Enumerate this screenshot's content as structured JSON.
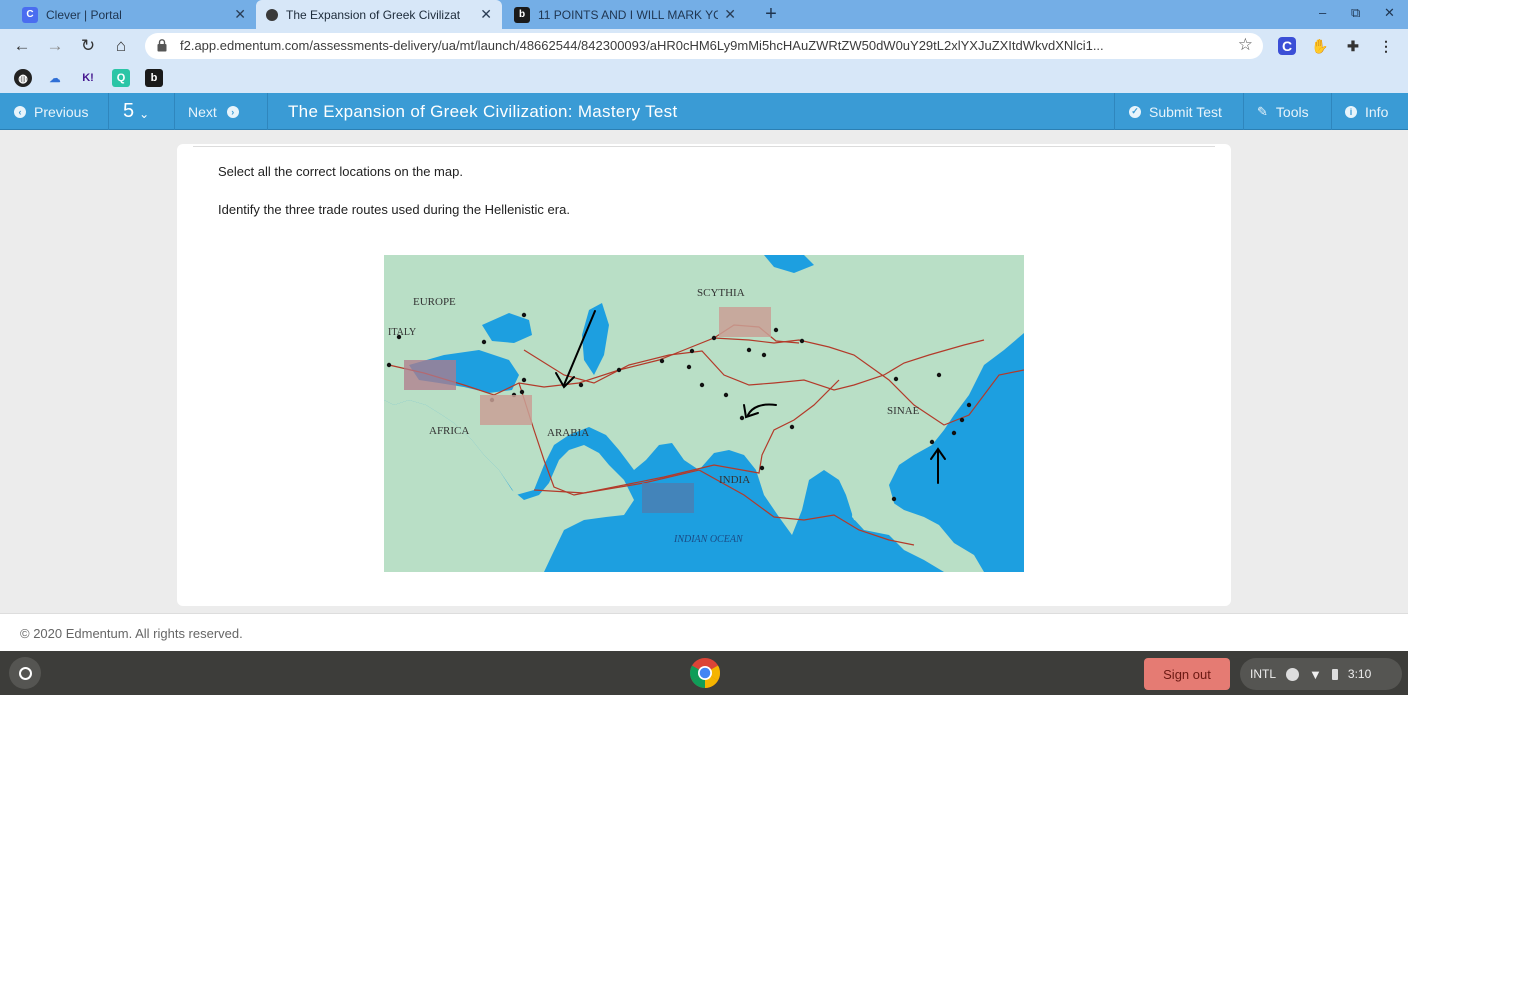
{
  "browser": {
    "tabs": [
      {
        "title": "Clever | Portal",
        "favicon": "C",
        "favicon_color": "#4a6df0",
        "active": false
      },
      {
        "title": "The Expansion of Greek Civilizat",
        "favicon": "e",
        "favicon_color": "#3a3a3a",
        "active": true
      },
      {
        "title": "11 POINTS AND I WILL MARK YO",
        "favicon": "b",
        "favicon_color": "#1a1a1a",
        "active": false
      }
    ],
    "new_tab_glyph": "+",
    "window_controls": [
      "–",
      "⧉",
      "✕"
    ],
    "url": "f2.app.edmentum.com/assessments-delivery/ua/mt/launch/48662544/842300093/aHR0cHM6Ly9mMi5hcHAuZWRtZW50dW0uY29tL2xlYXJuZXItdWkvdXNlci1...",
    "nav_icons": [
      "back-icon",
      "forward-icon",
      "reload-icon",
      "home-icon"
    ],
    "extensions": [
      "clever-extension-icon",
      "hand-extension-icon",
      "puzzle-extensions-icon",
      "menu-dots-icon"
    ],
    "bookmarks": [
      "globe-bookmark-icon",
      "weather-bookmark-icon",
      "kahoot-bookmark-icon",
      "quizizz-bookmark-icon",
      "brainly-bookmark-icon"
    ]
  },
  "app": {
    "previous_label": "Previous",
    "question_number": "5",
    "next_label": "Next",
    "title": "The Expansion of Greek Civilization: Mastery Test",
    "submit_label": "Submit Test",
    "tools_label": "Tools",
    "info_label": "Info",
    "accent": "#3a9bd5"
  },
  "question": {
    "instruction": "Select all the correct locations on the map.",
    "prompt": "Identify the three trade routes used during the Hellenistic era."
  },
  "map": {
    "labels": [
      "EUROPE",
      "SCYTHIA",
      "ITALY",
      "AFRICA",
      "ARABIA",
      "SINAE",
      "INDIA",
      "INDIAN OCEAN"
    ],
    "hotspot_count": 4,
    "hand_drawn_arrow_count": 3,
    "land_color": "#b9dfc6",
    "water_color": "#1d9fe0",
    "route_color": "#b33a2a"
  },
  "footer": {
    "copyright": "© 2020 Edmentum. All rights reserved."
  },
  "shelf": {
    "sign_out_label": "Sign out",
    "input_method": "INTL",
    "time": "3:10"
  }
}
